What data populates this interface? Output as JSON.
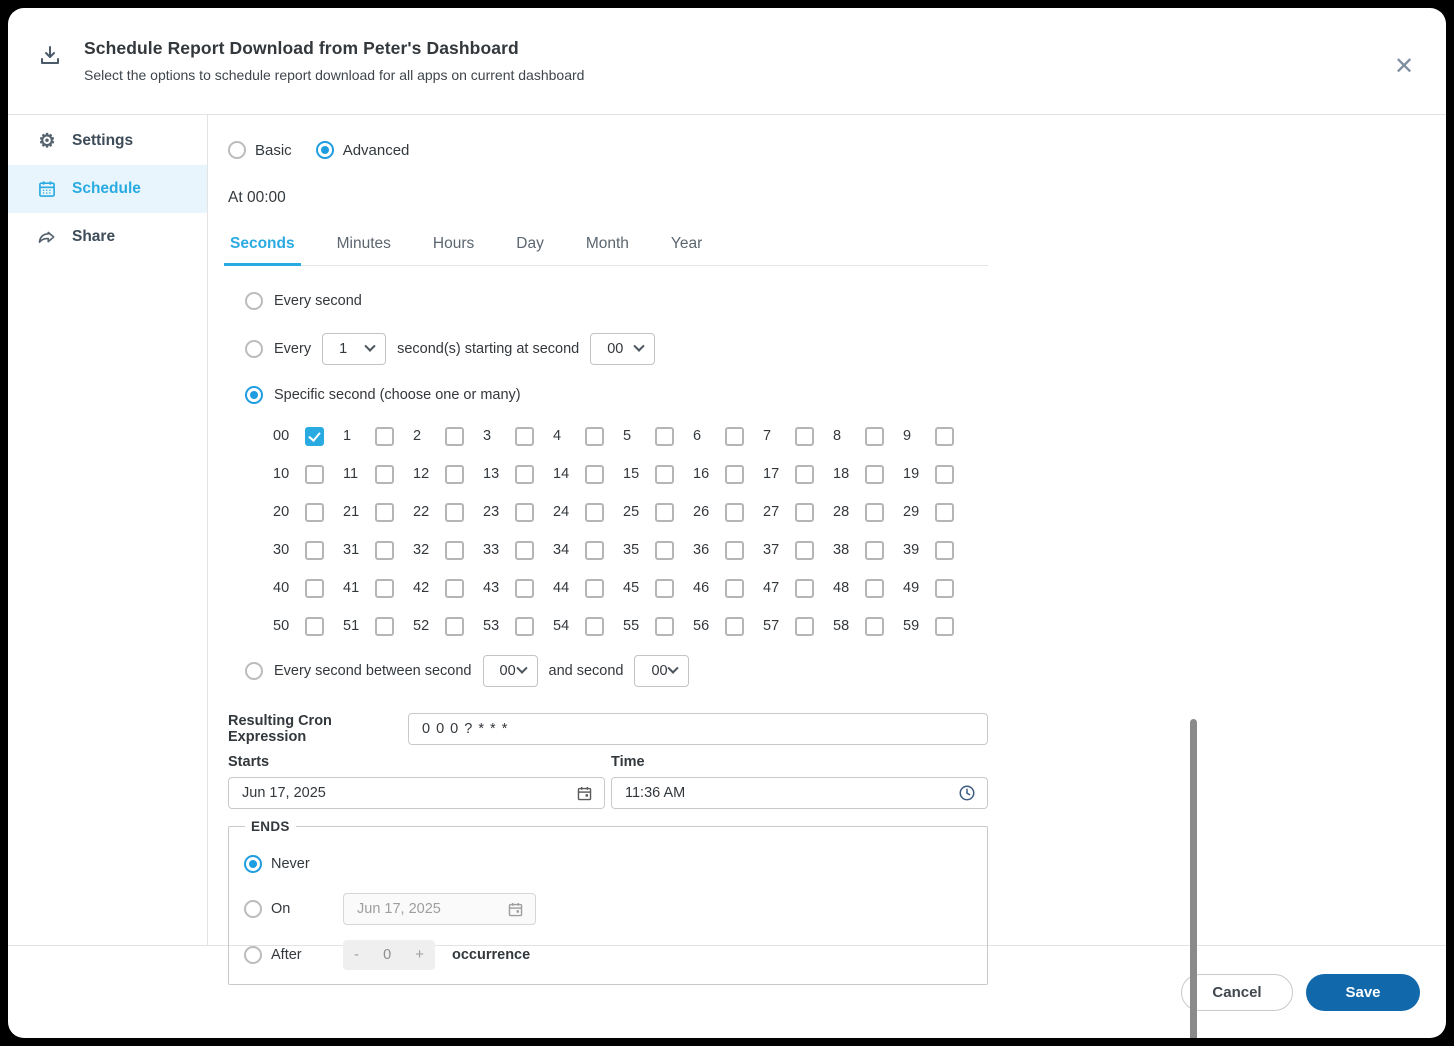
{
  "accent_color": "#29abe2",
  "save_color": "#1168ab",
  "header": {
    "title": "Schedule Report Download from Peter's Dashboard",
    "subtitle": "Select the options to schedule report download for all apps on current dashboard",
    "close_glyph": "✕"
  },
  "sidebar": {
    "items": [
      {
        "label": "Settings",
        "icon": "gear-icon",
        "active": false
      },
      {
        "label": "Schedule",
        "icon": "calendar-icon",
        "active": true
      },
      {
        "label": "Share",
        "icon": "share-icon",
        "active": false
      }
    ]
  },
  "mode": {
    "basic_label": "Basic",
    "advanced_label": "Advanced",
    "selected": "Advanced"
  },
  "summary_text": "At 00:00",
  "tabs": {
    "items": [
      "Seconds",
      "Minutes",
      "Hours",
      "Day",
      "Month",
      "Year"
    ],
    "active": "Seconds"
  },
  "seconds": {
    "every_second": {
      "label": "Every second",
      "selected": false
    },
    "every_n": {
      "prefix": "Every",
      "n_value": "1",
      "middle": "second(s) starting at second",
      "start_value": "00",
      "selected": false
    },
    "specific": {
      "label": "Specific second (choose one or many)",
      "selected": true
    },
    "grid": [
      "00",
      "1",
      "2",
      "3",
      "4",
      "5",
      "6",
      "7",
      "8",
      "9",
      "10",
      "11",
      "12",
      "13",
      "14",
      "15",
      "16",
      "17",
      "18",
      "19",
      "20",
      "21",
      "22",
      "23",
      "24",
      "25",
      "26",
      "27",
      "28",
      "29",
      "30",
      "31",
      "32",
      "33",
      "34",
      "35",
      "36",
      "37",
      "38",
      "39",
      "40",
      "41",
      "42",
      "43",
      "44",
      "45",
      "46",
      "47",
      "48",
      "49",
      "50",
      "51",
      "52",
      "53",
      "54",
      "55",
      "56",
      "57",
      "58",
      "59"
    ],
    "checked": [
      "00"
    ],
    "between": {
      "prefix": "Every second between second",
      "from_value": "00",
      "middle": "and second",
      "to_value": "00",
      "selected": false
    }
  },
  "cron": {
    "label": "Resulting Cron Expression",
    "value": "0 0 0 ? * * *"
  },
  "starts": {
    "label": "Starts",
    "value": "Jun 17, 2025"
  },
  "time": {
    "label": "Time",
    "value": "11:36 AM"
  },
  "ends": {
    "legend": "ENDS",
    "never": {
      "label": "Never",
      "selected": true
    },
    "on": {
      "label": "On",
      "value": "Jun 17, 2025",
      "selected": false
    },
    "after": {
      "label": "After",
      "minus": "-",
      "value": "0",
      "plus": "+",
      "suffix": "occurrence",
      "selected": false
    }
  },
  "footer": {
    "cancel_label": "Cancel",
    "save_label": "Save"
  }
}
